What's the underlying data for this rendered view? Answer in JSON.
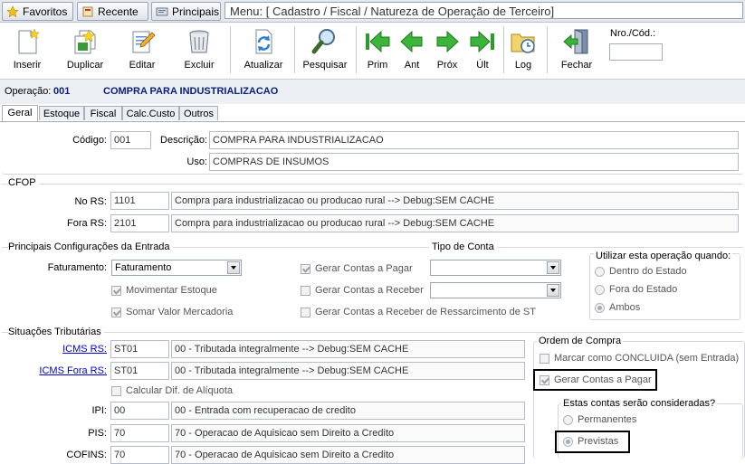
{
  "topbar": {
    "favoritos": "Favoritos",
    "recente": "Recente",
    "principais": "Principais",
    "menu": "Menu: [ Cadastro / Fiscal / Natureza de Operação de Terceiro]"
  },
  "toolbar": {
    "inserir": "Inserir",
    "duplicar": "Duplicar",
    "editar": "Editar",
    "excluir": "Excluir",
    "atualizar": "Atualizar",
    "pesquisar": "Pesquisar",
    "prim": "Prim",
    "ant": "Ant",
    "prox": "Próx",
    "ult": "Últ",
    "log": "Log",
    "fechar": "Fechar",
    "nro_label": "Nro./Cód.:",
    "nro_value": ""
  },
  "operation": {
    "label": "Operação:",
    "code": "001",
    "name": "COMPRA PARA INDUSTRIALIZACAO"
  },
  "tabs": [
    "Geral",
    "Estoque",
    "Fiscal",
    "Calc.Custo",
    "Outros"
  ],
  "geral": {
    "codigo_label": "Código:",
    "codigo": "001",
    "descricao_label": "Descrição:",
    "descricao": "COMPRA PARA INDUSTRIALIZACAO",
    "uso_label": "Uso:",
    "uso": "COMPRAS DE INSUMOS"
  },
  "cfop": {
    "title": "CFOP",
    "no_rs_label": "No RS:",
    "no_rs_code": "1101",
    "no_rs_desc": "Compra para industrializacao ou producao rural   --> Debug:SEM CACHE",
    "fora_rs_label": "Fora RS:",
    "fora_rs_code": "2101",
    "fora_rs_desc": "Compra para industrializacao ou producao rural   --> Debug:SEM CACHE"
  },
  "config": {
    "title": "Principais Configurações da Entrada",
    "faturamento_label": "Faturamento:",
    "faturamento_value": "Faturamento",
    "movimentar_estoque": "Movimentar Estoque",
    "somar_valor": "Somar Valor Mercadoria",
    "gerar_pagar": "Gerar Contas a Pagar",
    "gerar_receber": "Gerar Contas a Receber",
    "gerar_ressarcimento": "Gerar Contas a Receber de Ressarcimento de ST",
    "tipo_conta_title": "Tipo de Conta",
    "utilizar_title": "Utilizar esta operação quando:",
    "dentro_estado": "Dentro do  Estado",
    "fora_estado": "Fora do Estado",
    "ambos": "Ambos"
  },
  "situacoes": {
    "title": "Situações Tributárias",
    "icms_rs_label": "ICMS RS:",
    "icms_rs_code": "ST01",
    "icms_rs_desc": "00 - Tributada integralmente   --> Debug:SEM CACHE",
    "icms_fora_label": "ICMS Fora RS:",
    "icms_fora_code": "ST01",
    "icms_fora_desc": "00 - Tributada integralmente   --> Debug:SEM CACHE",
    "calcular_dif": "Calcular Dif. de Alíquota",
    "ipi_label": "IPI:",
    "ipi_code": "00",
    "ipi_desc": "00 - Entrada com recuperacao de credito",
    "pis_label": "PIS:",
    "pis_code": "70",
    "pis_desc": "70 - Operacao de Aquisicao sem Direito a Credito",
    "cofins_label": "COFINS:",
    "cofins_code": "70",
    "cofins_desc": "70 - Operacao de Aquisicao sem Direito a Credito"
  },
  "ordem": {
    "title": "Ordem de Compra",
    "marcar_concluida": "Marcar como CONCLUIDA (sem Entrada)",
    "gerar_pagar": "Gerar Contas a Pagar",
    "estas_contas": "Estas contas serão consideradas?",
    "permanentes": "Permanentes",
    "previstas": "Previstas"
  }
}
